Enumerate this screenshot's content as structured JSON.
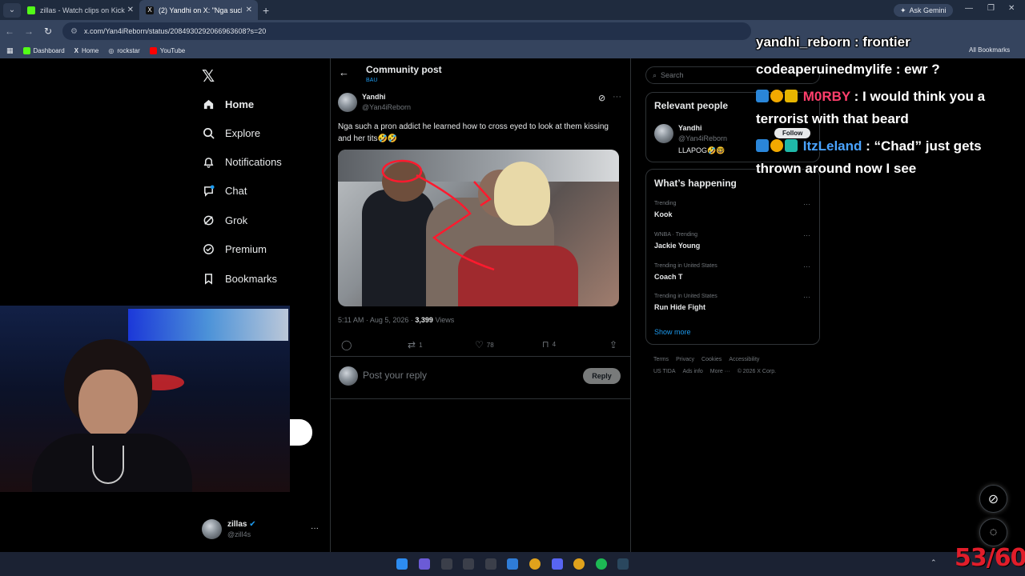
{
  "browser": {
    "tabs": [
      {
        "title": "zillas - Watch clips on Kick",
        "active": false,
        "favicon_color": "#53fc18"
      },
      {
        "title": "(2) Yandhi on X: \"Nga such a p",
        "active": true,
        "favicon_color": "#e7e9ea"
      }
    ],
    "new_tab": "+",
    "ask_gemini": "Ask Gemini",
    "url": "x.com/Yan4iReborn/status/2084930292066963608?s=20",
    "bookmarks": [
      {
        "label": "Dashboard",
        "color": "#53fc18"
      },
      {
        "label": "Home",
        "color": "#e7e9ea"
      },
      {
        "label": "rockstar",
        "color": "#e7e9ea"
      },
      {
        "label": "YouTube",
        "color": "#ff0000"
      }
    ],
    "all_bookmarks": "All Bookmarks"
  },
  "sidebar": {
    "items": [
      {
        "label": "Home",
        "icon": "home-icon"
      },
      {
        "label": "Explore",
        "icon": "search-icon"
      },
      {
        "label": "Notifications",
        "icon": "bell-icon"
      },
      {
        "label": "Chat",
        "icon": "chat-icon"
      },
      {
        "label": "Grok",
        "icon": "grok-icon"
      },
      {
        "label": "Premium",
        "icon": "premium-icon"
      },
      {
        "label": "Bookmarks",
        "icon": "bookmark-icon"
      }
    ],
    "account": {
      "name": "zillas",
      "handle": "@zill4s"
    }
  },
  "header": {
    "title": "Community post",
    "subtitle": "BAU"
  },
  "post": {
    "author": "Yandhi",
    "handle": "@Yan4iReborn",
    "text": "Nga such a pron addict he learned how to cross eyed to look at them kissing and her tits🤣🤣",
    "time": "5:11 AM · Aug 5, 2026 · ",
    "views_count": "3,399",
    "views_label": " Views",
    "actions": {
      "replies": "",
      "reposts": "1",
      "likes": "78",
      "bookmarks": "4"
    },
    "reply_placeholder": "Post your reply",
    "reply_button": "Reply"
  },
  "right": {
    "search_placeholder": "Search",
    "relevant_title": "Relevant people",
    "person": {
      "name": "Yandhi",
      "handle": "@Yan4iReborn",
      "bio": "LLAPOG🤣🤓",
      "follow": "Follow"
    },
    "happening_title": "What’s happening",
    "trends": [
      {
        "label": "Trending",
        "name": "Kook"
      },
      {
        "label": "WNBA · Trending",
        "name": "Jackie Young"
      },
      {
        "label": "Trending in United States",
        "name": "Coach T"
      },
      {
        "label": "Trending in United States",
        "name": "Run Hide Fight"
      }
    ],
    "show_more": "Show more",
    "footer_row1": [
      "Terms",
      "Privacy",
      "Cookies",
      "Accessibility"
    ],
    "footer_row2": [
      "US TIDA",
      "Ads info",
      "More ···",
      "© 2026 X Corp."
    ]
  },
  "chat": [
    {
      "user": "yandhi_reborn",
      "sep": " : ",
      "msg": "frontier",
      "user_color": "#ffffff",
      "badges": false
    },
    {
      "user": "codeaperuinedmylife",
      "sep": " : ",
      "msg": "ewr ?",
      "user_color": "#ffffff",
      "badges": false
    },
    {
      "user": "M0RBY",
      "sep": " : ",
      "msg": "I would think you a",
      "user_color": "#ff3f6c",
      "badges": true
    },
    {
      "user": "",
      "sep": "",
      "msg": "terrorist with that beard",
      "user_color": "#ffffff",
      "badges": false
    },
    {
      "user": "ItzLeland",
      "sep": " : ",
      "msg": "“Chad” just gets",
      "user_color": "#4aa3ff",
      "badges": true
    },
    {
      "user": "",
      "sep": "",
      "msg": "thrown around now I see",
      "user_color": "#ffffff",
      "badges": false
    }
  ],
  "counter": "53/60",
  "colors": {
    "accent": "#1d9bf0",
    "text": "#e7e9ea",
    "muted": "#71767b",
    "border": "#2f3336"
  }
}
